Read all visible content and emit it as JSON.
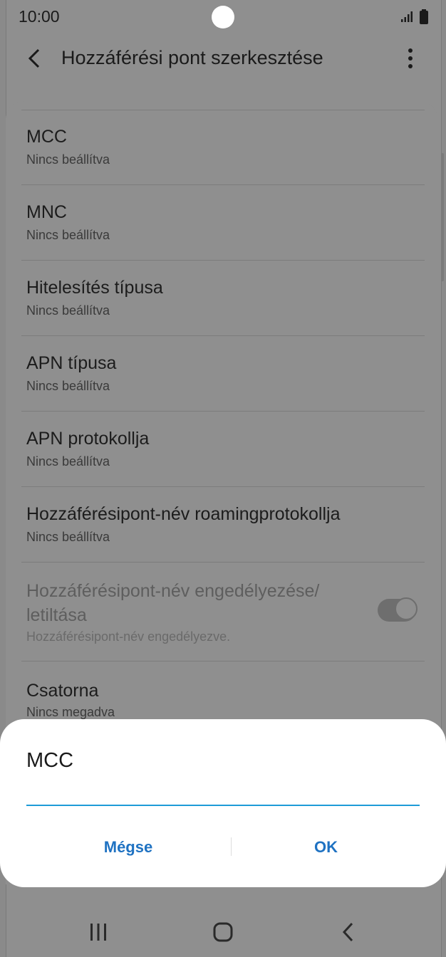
{
  "status_bar": {
    "time": "10:00"
  },
  "app_bar": {
    "title": "Hozzáférési pont szerkesztése"
  },
  "settings": [
    {
      "title": "MCC",
      "value": "Nincs beállítva"
    },
    {
      "title": "MNC",
      "value": "Nincs beállítva"
    },
    {
      "title": "Hitelesítés típusa",
      "value": "Nincs beállítva"
    },
    {
      "title": "APN típusa",
      "value": "Nincs beállítva"
    },
    {
      "title": "APN protokollja",
      "value": "Nincs beállítva"
    },
    {
      "title": "Hozzáférésipont-név roamingprotokollja",
      "value": "Nincs beállítva"
    },
    {
      "title_line1": "Hozzáférésipont-név engedélyezése/",
      "title_line2": "letiltása",
      "value": "Hozzáférésipont-név engedélyezve.",
      "toggle_on": true,
      "disabled": true
    },
    {
      "title": "Csatorna",
      "value": "Nincs megadva"
    }
  ],
  "dialog": {
    "title": "MCC",
    "input_value": "",
    "cancel_label": "Mégse",
    "ok_label": "OK"
  },
  "colors": {
    "accent": "#1e9bd7",
    "button_text": "#1f72c2",
    "dim_background": "#8f8f8f"
  },
  "icons": [
    "back-arrow-icon",
    "more-vert-icon",
    "signal-icon",
    "battery-icon",
    "recents-icon",
    "home-icon",
    "nav-back-icon"
  ]
}
